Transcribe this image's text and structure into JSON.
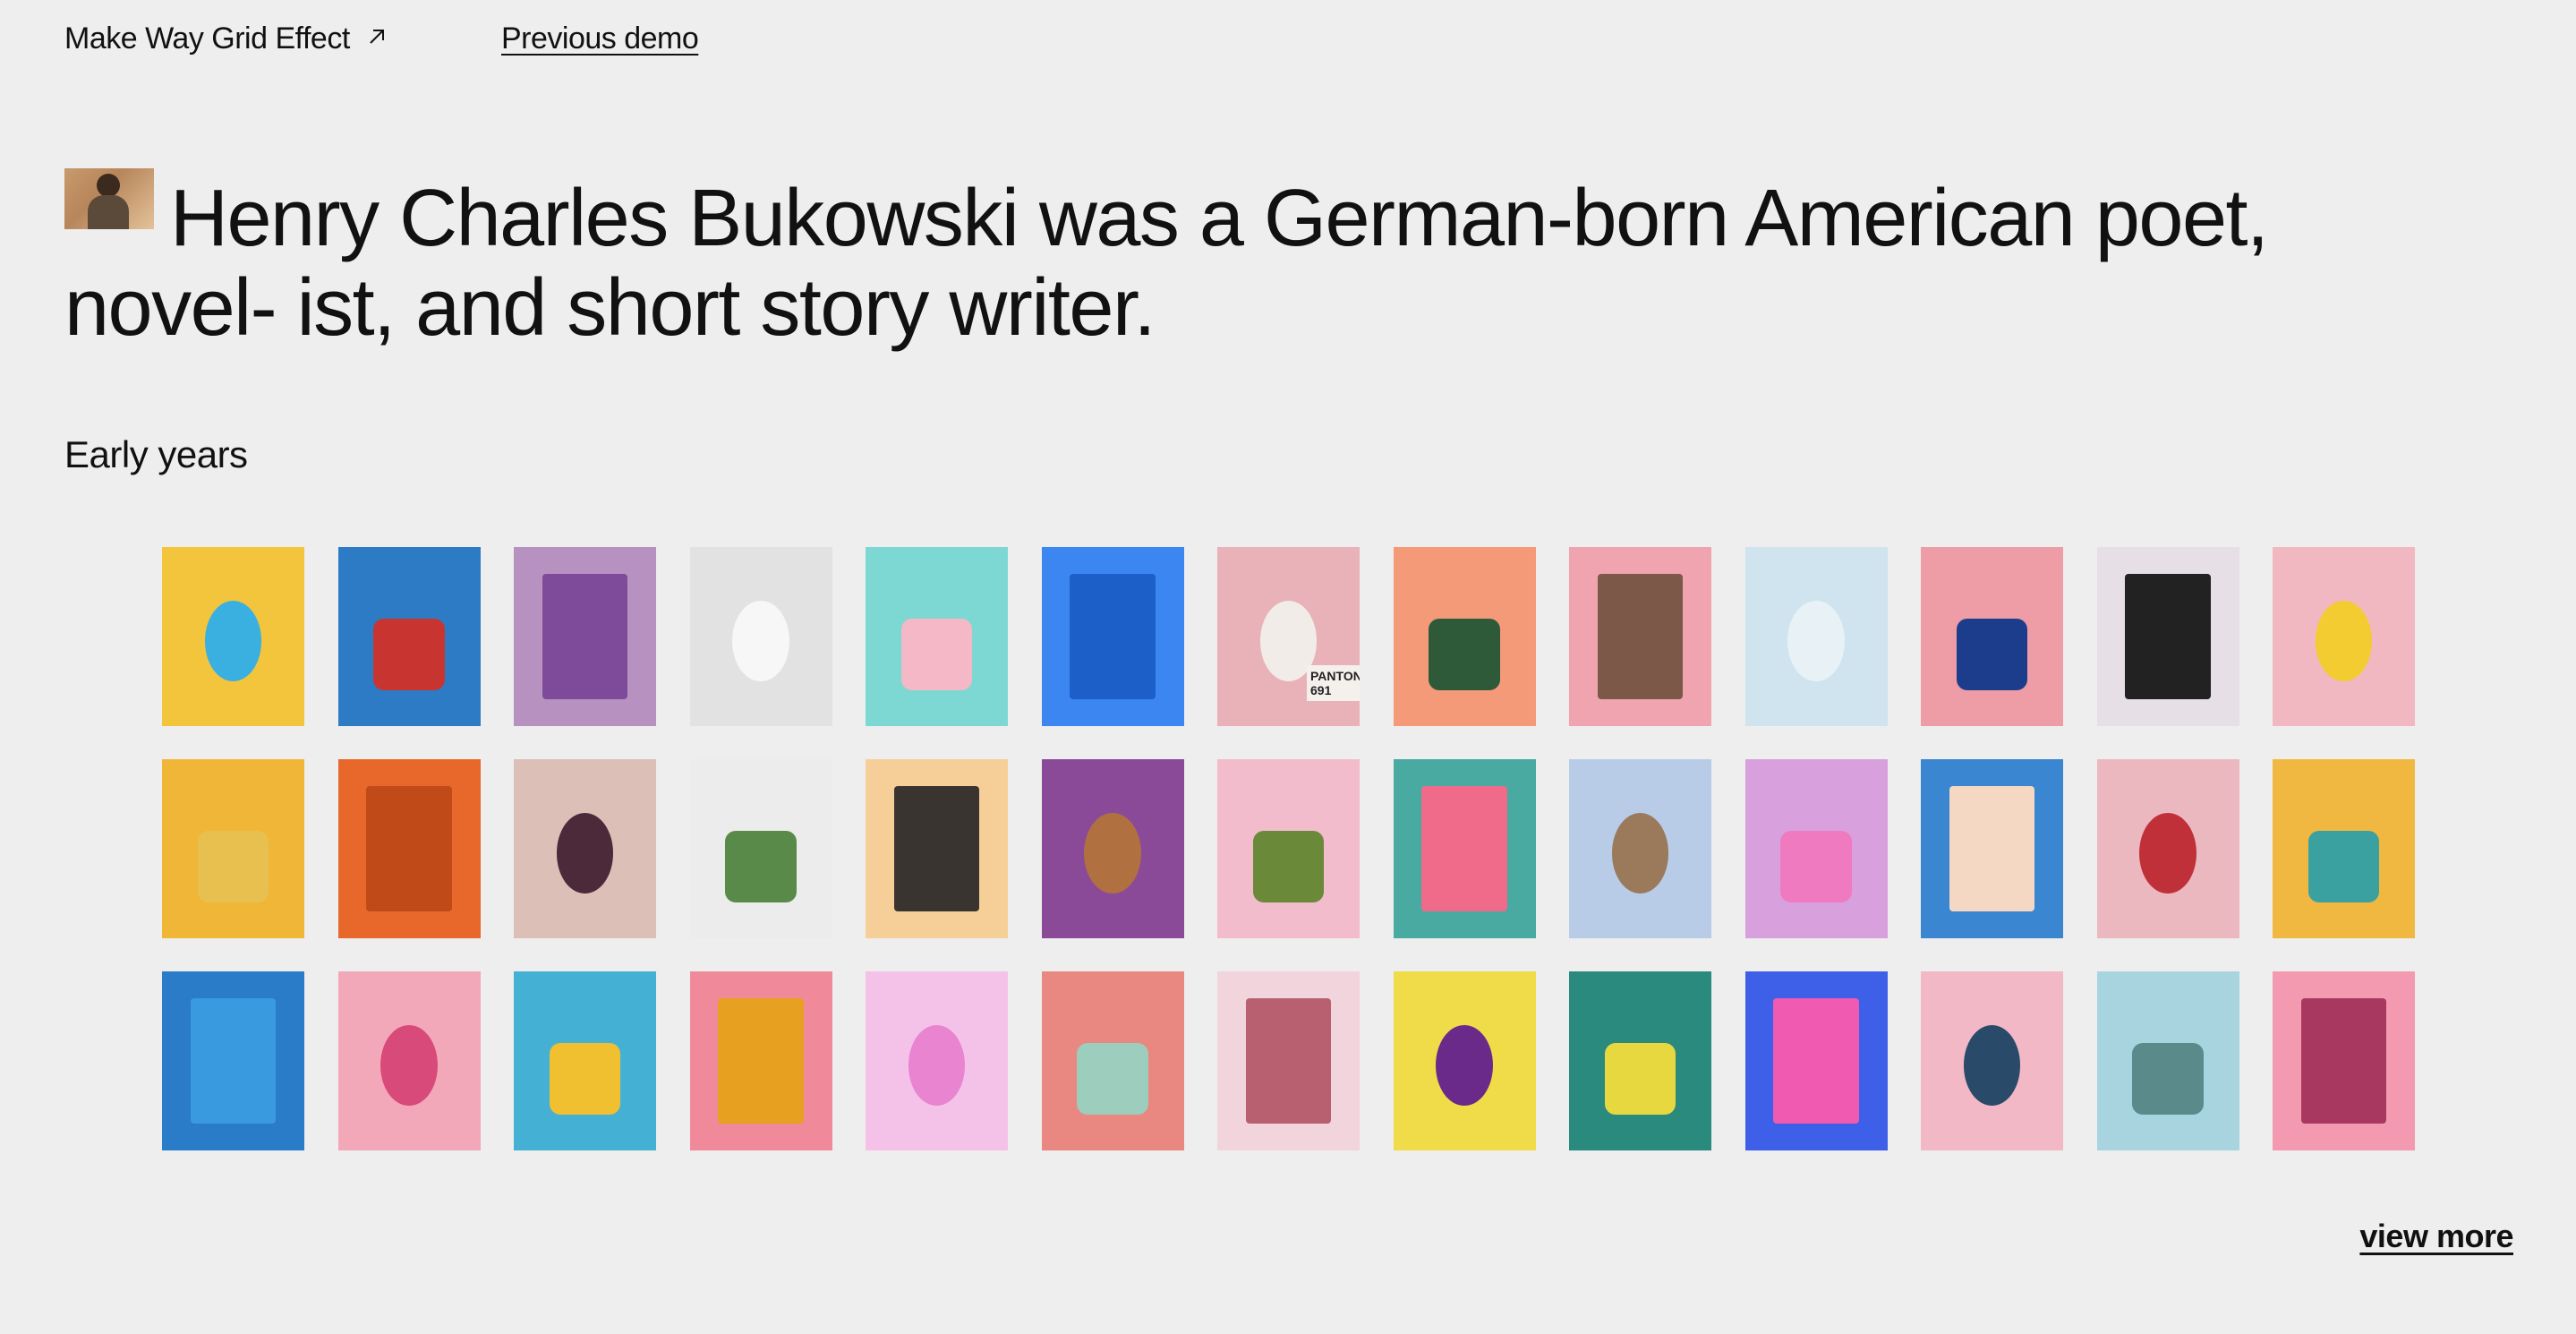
{
  "header": {
    "site_title": "Make Way Grid Effect",
    "external_icon": "arrow-up-right-icon",
    "previous_demo": "Previous demo"
  },
  "headline": {
    "text": "Henry Charles Bukowski was a German-born American poet, novel- ist, and short story writer.",
    "thumbnail": "portrait-photo"
  },
  "section": {
    "label": "Early years"
  },
  "grid": {
    "tiles": [
      {
        "name": "hand-peace-sign",
        "bg": "#f2c53d",
        "accent": "#39b0e0"
      },
      {
        "name": "blue-red-vases",
        "bg": "#2c7bc4",
        "accent": "#c83530"
      },
      {
        "name": "purple-door",
        "bg": "#b792c0",
        "accent": "#7e4a9a"
      },
      {
        "name": "white-watch",
        "bg": "#e2e2e2",
        "accent": "#f7f7f7"
      },
      {
        "name": "gumball-machine",
        "bg": "#7dd8d4",
        "accent": "#f4b8c6"
      },
      {
        "name": "blue-sneaker",
        "bg": "#3b86f0",
        "accent": "#1c5fc8"
      },
      {
        "name": "pantone-spoon",
        "bg": "#e8b2b8",
        "accent": "#f2ece8",
        "label": "PANTONE 691"
      },
      {
        "name": "green-plant-leaf",
        "bg": "#f49a78",
        "accent": "#2f5a3a"
      },
      {
        "name": "palm-leaves",
        "bg": "#f0a4b0",
        "accent": "#7c5848"
      },
      {
        "name": "small-cactus",
        "bg": "#cfe4ee",
        "accent": "#e8f2f6"
      },
      {
        "name": "pink-brick-wall",
        "bg": "#ee9ca6",
        "accent": "#1c3c8c"
      },
      {
        "name": "vintage-camera",
        "bg": "#e6dfe6",
        "accent": "#222222"
      },
      {
        "name": "banana",
        "bg": "#f2b8c2",
        "accent": "#f2cc30"
      },
      {
        "name": "game-boy",
        "bg": "#f0b638",
        "accent": "#e8c050"
      },
      {
        "name": "orange-wall",
        "bg": "#e8682c",
        "accent": "#c04a18"
      },
      {
        "name": "pink-sneaker",
        "bg": "#dcc0b8",
        "accent": "#4c2a3a"
      },
      {
        "name": "glass-with-leaf",
        "bg": "#ececec",
        "accent": "#5a8a4a"
      },
      {
        "name": "dark-leaves",
        "bg": "#f6cf98",
        "accent": "#3a3430"
      },
      {
        "name": "egg-with-sprout",
        "bg": "#8a4a98",
        "accent": "#b07040"
      },
      {
        "name": "avocado-half",
        "bg": "#f2bccc",
        "accent": "#6a8a3a"
      },
      {
        "name": "flamingo-float",
        "bg": "#48aaa0",
        "accent": "#f06a8a"
      },
      {
        "name": "cone-object",
        "bg": "#b8cce8",
        "accent": "#9a7a5a"
      },
      {
        "name": "pink-curves",
        "bg": "#d8a0dc",
        "accent": "#f07ac0"
      },
      {
        "name": "peach-flower",
        "bg": "#3a86d0",
        "accent": "#f4d8c4"
      },
      {
        "name": "red-shape",
        "bg": "#ecb8c0",
        "accent": "#c03038"
      },
      {
        "name": "teal-doors",
        "bg": "#f0b840",
        "accent": "#3aa0a0"
      },
      {
        "name": "blue-ball",
        "bg": "#2a7cc8",
        "accent": "#3a9ae0"
      },
      {
        "name": "pink-pineapple",
        "bg": "#f2a8b8",
        "accent": "#d84a7a"
      },
      {
        "name": "blue-yellow-wall",
        "bg": "#44b0d4",
        "accent": "#f0c030"
      },
      {
        "name": "yellow-chair",
        "bg": "#f08a9a",
        "accent": "#e8a020"
      },
      {
        "name": "pink-balloons",
        "bg": "#f4c2e8",
        "accent": "#e884d0"
      },
      {
        "name": "legs-on-court",
        "bg": "#e88880",
        "accent": "#9ccdbd"
      },
      {
        "name": "lips-torn-paper",
        "bg": "#f2d4dc",
        "accent": "#b86070"
      },
      {
        "name": "yellow-tub",
        "bg": "#f0dc48",
        "accent": "#6a2a8a"
      },
      {
        "name": "yellow-stairs",
        "bg": "#2a8a7e",
        "accent": "#e8d840"
      },
      {
        "name": "pink-lamp",
        "bg": "#3e60e8",
        "accent": "#f05ab0"
      },
      {
        "name": "hand-with-cup",
        "bg": "#f2b8c6",
        "accent": "#2a4a6a"
      },
      {
        "name": "church-spire",
        "bg": "#a8d4e0",
        "accent": "#5a8a8a"
      },
      {
        "name": "pink-tower",
        "bg": "#f49ab0",
        "accent": "#a83860"
      }
    ]
  },
  "footer": {
    "view_more": "view more"
  }
}
